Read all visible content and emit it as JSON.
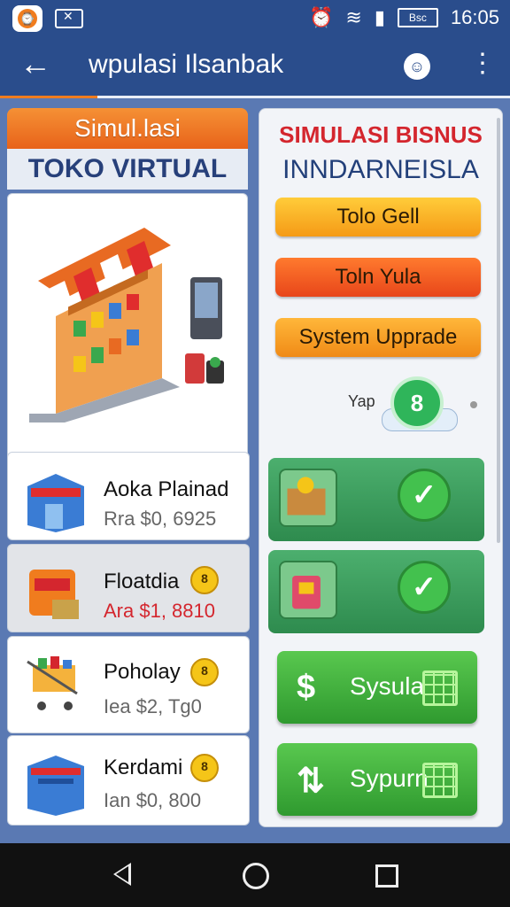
{
  "statusbar": {
    "time": "16:05",
    "battery": "Bsc"
  },
  "appbar": {
    "title": "wpulasi Ilsanbak"
  },
  "left": {
    "header_top": "Simul.lasi",
    "header_bottom": "TOKO VIRTUAL",
    "items": [
      {
        "name": "Aoka Plainad",
        "price": "Rra $0, 6925",
        "price_color": "#666666"
      },
      {
        "name": "Floatdia",
        "price": "Ara $1, 8810",
        "price_color": "#d4262e",
        "coin": "8"
      },
      {
        "name": "Poholay",
        "price": "Iea $2, Tg0",
        "price_color": "#666666",
        "coin": "8"
      },
      {
        "name": "Kerdami",
        "price": "Ian $0, 800",
        "price_color": "#666666",
        "coin": "8"
      }
    ]
  },
  "right": {
    "title1": "SIMULASI BISNUS",
    "title2": "INNDARNEISLA",
    "buttons": [
      "Tolo Gell",
      "Toln Yula",
      "System Upprade"
    ],
    "badge_text": "Yap",
    "badge_value": "8",
    "actions": [
      "Sysula",
      "Sypurn"
    ]
  },
  "colors": {
    "accent": "#f07c1e",
    "primary": "#2a4d8c",
    "green": "#3aa84d",
    "red": "#d4262e"
  }
}
